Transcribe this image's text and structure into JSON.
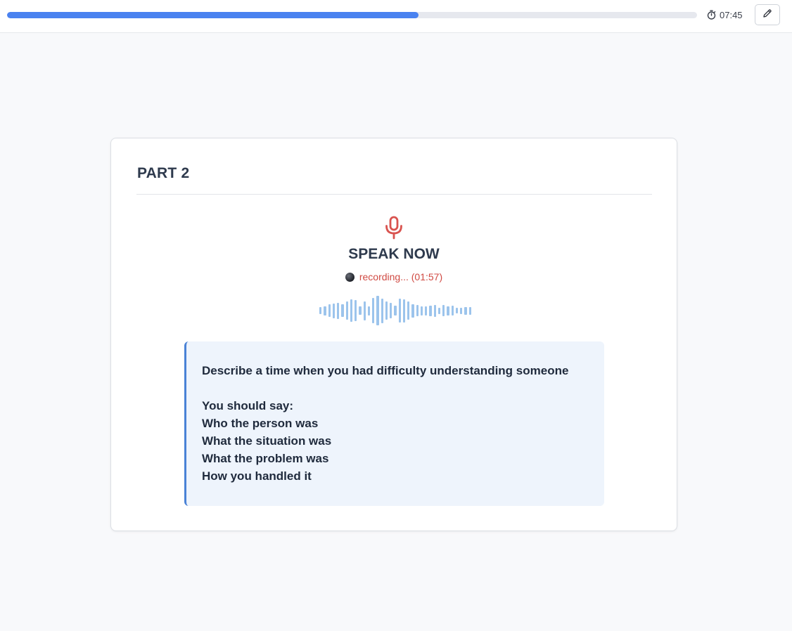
{
  "header": {
    "progress_percent": 59.6,
    "timer": "07:45",
    "timer_icon": "stopwatch-icon",
    "edit_icon": "pencil-icon"
  },
  "card": {
    "part_title": "PART 2",
    "mic_icon": "microphone-icon",
    "speak_now": "SPEAK NOW",
    "recording_status": "recording... (01:57)",
    "waveform_levels": [
      0.22,
      0.3,
      0.4,
      0.48,
      0.52,
      0.4,
      0.6,
      0.72,
      0.68,
      0.28,
      0.62,
      0.3,
      0.82,
      0.95,
      0.8,
      0.6,
      0.5,
      0.32,
      0.78,
      0.74,
      0.58,
      0.44,
      0.36,
      0.3,
      0.3,
      0.34,
      0.38,
      0.2,
      0.36,
      0.3,
      0.32,
      0.18,
      0.2,
      0.26,
      0.24
    ]
  },
  "prompt": {
    "topic": "Describe a time when you had difficulty understanding someone",
    "you_should_say": "You should say:",
    "points": [
      "Who the person was",
      "What the situation was",
      "What the problem was",
      "How you handled it"
    ]
  },
  "colors": {
    "accent": "#4a82f0",
    "recording": "#d04a43",
    "waveform": "#9cc4ec",
    "prompt_background": "#eef4fc"
  }
}
